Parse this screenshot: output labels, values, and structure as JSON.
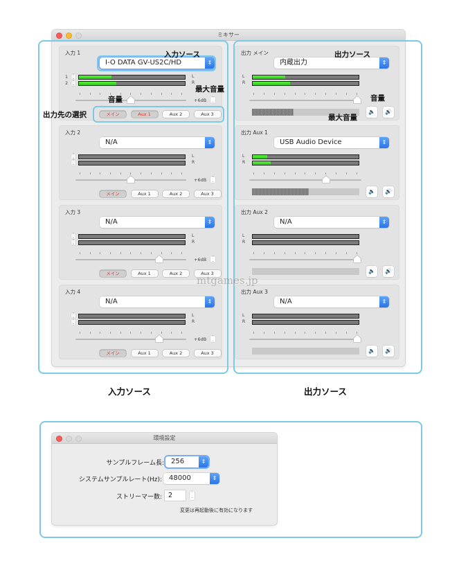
{
  "mixer": {
    "title": "ミキサー",
    "inputs": [
      {
        "label": "入力 1",
        "source": "I-O DATA GV-US2C/HD",
        "focused": true,
        "channel_labels": [
          "1",
          "2"
        ],
        "meter_levels": [
          0.31,
          0.35
        ],
        "volume": 0.5,
        "max_gain": "+6dB",
        "routes": [
          {
            "label": "メイン",
            "selected": true
          },
          {
            "label": "Aux 1",
            "selected": true
          },
          {
            "label": "Aux 2",
            "selected": false
          },
          {
            "label": "Aux 3",
            "selected": false
          }
        ]
      },
      {
        "label": "入力 2",
        "source": "N/A",
        "focused": false,
        "channel_labels": [
          "",
          ""
        ],
        "meter_levels": [
          0,
          0
        ],
        "volume": 0.5,
        "max_gain": "+6dB",
        "routes": [
          {
            "label": "メイン",
            "selected": true
          },
          {
            "label": "Aux 1",
            "selected": false
          },
          {
            "label": "Aux 2",
            "selected": false
          },
          {
            "label": "Aux 3",
            "selected": false
          }
        ]
      },
      {
        "label": "入力 3",
        "source": "N/A",
        "focused": false,
        "channel_labels": [
          "",
          ""
        ],
        "meter_levels": [
          0,
          0
        ],
        "volume": 0.78,
        "max_gain": "+6dB",
        "routes": [
          {
            "label": "メイン",
            "selected": true
          },
          {
            "label": "Aux 1",
            "selected": false
          },
          {
            "label": "Aux 2",
            "selected": false
          },
          {
            "label": "Aux 3",
            "selected": false
          }
        ]
      },
      {
        "label": "入力 4",
        "source": "N/A",
        "focused": false,
        "channel_labels": [
          "",
          ""
        ],
        "meter_levels": [
          0,
          0
        ],
        "volume": 0.78,
        "max_gain": "+6dB",
        "routes": [
          {
            "label": "メイン",
            "selected": true
          },
          {
            "label": "Aux 1",
            "selected": false
          },
          {
            "label": "Aux 2",
            "selected": false
          },
          {
            "label": "Aux 3",
            "selected": false
          }
        ]
      }
    ],
    "outputs": [
      {
        "label": "出力 メイン",
        "source": "内蔵出力",
        "meter_levels": [
          0.31,
          0.35
        ],
        "volume": 1.0,
        "level": 0.39
      },
      {
        "label": "出力 Aux 1",
        "source": "USB Audio Device",
        "meter_levels": [
          0.14,
          0.17
        ],
        "volume": 0.7,
        "level": 0.53
      },
      {
        "label": "出力 Aux 2",
        "source": "N/A",
        "meter_levels": [
          0,
          0
        ],
        "volume": 1.0,
        "level": 0
      },
      {
        "label": "出力 Aux 3",
        "source": "N/A",
        "meter_levels": [
          0,
          0
        ],
        "volume": 1.0,
        "level": 0
      }
    ],
    "lr_labels": [
      "L",
      "R"
    ],
    "volume_down_icon": "🔈",
    "volume_up_icon": "🔊"
  },
  "annotations": {
    "input_source": "入力ソース",
    "output_source": "出力ソース",
    "max_volume_left": "最大音量",
    "volume_left": "音量",
    "route_select": "出力先の選択",
    "volume_right": "音量",
    "max_volume_right": "最大音量",
    "input_section": "入力ソース",
    "output_section": "出力ソース",
    "prefs_section": "環境設定"
  },
  "watermark": "mtgames.jp",
  "prefs": {
    "title": "環境設定",
    "sample_frame_label": "サンプルフレーム長:",
    "sample_frame_value": "256",
    "sample_rate_label": "システムサンプルレート(Hz):",
    "sample_rate_value": "48000",
    "streamer_label": "ストリーマー数:",
    "streamer_value": "2",
    "note": "変更は再起動後に有効になります"
  }
}
